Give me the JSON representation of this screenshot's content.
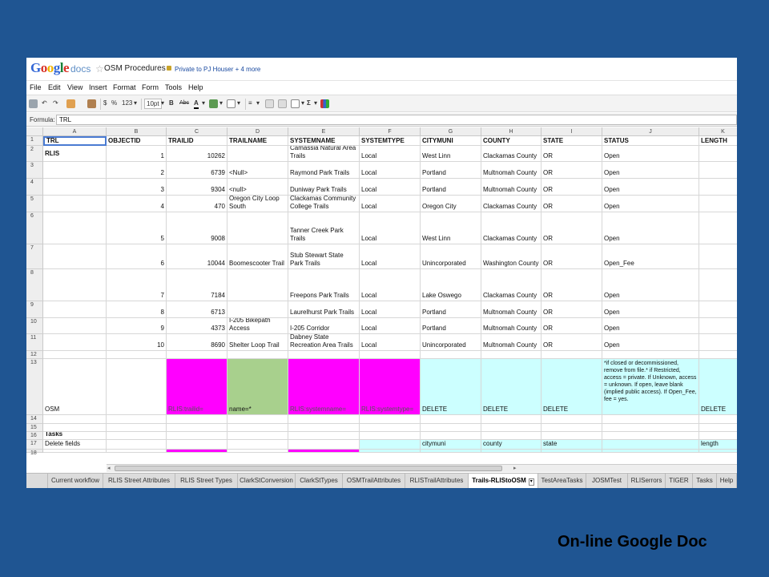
{
  "app": {
    "logo_google": "Google",
    "logo_docs": "docs",
    "doc_title": "OSM Procedures",
    "sharing": "Private to PJ Houser + 4 more"
  },
  "menu": [
    "File",
    "Edit",
    "View",
    "Insert",
    "Format",
    "Form",
    "Tools",
    "Help"
  ],
  "toolbar": {
    "currency": "$",
    "percent": "%",
    "number_format": "123",
    "font_size": "10pt",
    "bold": "B",
    "strike": "Abc",
    "text_color": "A",
    "sigma": "Σ"
  },
  "formula": {
    "label": "Formula:",
    "value": "TRL"
  },
  "columns": [
    "A",
    "B",
    "C",
    "D",
    "E",
    "F",
    "G",
    "H",
    "I",
    "J",
    "K"
  ],
  "row_numbers": [
    "1",
    "2",
    "3",
    "4",
    "5",
    "6",
    "7",
    "8",
    "9",
    "10",
    "11",
    "12",
    "13",
    "14",
    "15",
    "16",
    "17",
    "18"
  ],
  "header_row": [
    "TRL",
    "OBJECTID",
    "TRAILID",
    "TRAILNAME",
    "SYSTEMNAME",
    "SYSTEMTYPE",
    "CITYMUNI",
    "COUNTY",
    "STATE",
    "STATUS",
    "LENGTH"
  ],
  "rlis_label": "RLIS",
  "data_rows": [
    [
      "1",
      "10262",
      "",
      "Camassia Natural Area Trails",
      "Local",
      "West Linn",
      "Clackamas County",
      "OR",
      "Open"
    ],
    [
      "2",
      "6739",
      "<Null>",
      "Raymond Park Trails",
      "Local",
      "Portland",
      "Multnomah County",
      "OR",
      "Open"
    ],
    [
      "3",
      "9304",
      "<null>",
      "Duniway Park Trails",
      "Local",
      "Portland",
      "Multnomah County",
      "OR",
      "Open"
    ],
    [
      "4",
      "470",
      "Oregon City Loop South",
      "Clackamas Community College Trails",
      "Local",
      "Oregon City",
      "Clackamas County",
      "OR",
      "Open"
    ],
    [
      "5",
      "9008",
      "",
      "Tanner Creek Park Trails",
      "Local",
      "West Linn",
      "Clackamas County",
      "OR",
      "Open"
    ],
    [
      "6",
      "10044",
      "Boomescooter Trail",
      "Stub Stewart State Park Trails",
      "Local",
      "Unincorporated",
      "Washington County",
      "OR",
      "Open_Fee"
    ],
    [
      "7",
      "7184",
      "",
      "Freepons Park Trails",
      "Local",
      "Lake Oswego",
      "Clackamas County",
      "OR",
      "Open"
    ],
    [
      "8",
      "6713",
      "",
      "Laurelhurst Park Trails",
      "Local",
      "Portland",
      "Multnomah County",
      "OR",
      "Open"
    ],
    [
      "9",
      "4373",
      "I-205 Bikepath Access",
      "I-205 Corridor",
      "Local",
      "Portland",
      "Multnomah County",
      "OR",
      "Open"
    ],
    [
      "10",
      "8690",
      "Shelter Loop Trail",
      "Dabney State Recreation Area Trails",
      "Local",
      "Unincorporated",
      "Multnomah County",
      "OR",
      "Open"
    ]
  ],
  "osm_row": {
    "label": "OSM",
    "trailid": "RLIS:trailid=",
    "trailname": "name=*",
    "systemname": "RLIS:systemname=",
    "systemtype": "RLIS:systemtype=",
    "citymuni": "DELETE",
    "county": "DELETE",
    "state": "DELETE",
    "status": "*if closed or decommissioned, remove from file.* if Restricted, access = private. If Unknown, access = unknown. If open, leave blank (implied public access). If Open_Fee, fee = yes.",
    "length": "DELETE"
  },
  "tasks_label": "Tasks",
  "delete_row": {
    "label": "Delete fields",
    "citymuni": "citymuni",
    "county": "county",
    "state": "state",
    "length": "length"
  },
  "sheet_tabs": [
    "Current workflow",
    "RLIS Street Attributes",
    "RLIS Street Types",
    "ClarkStConversion",
    "ClarkStTypes",
    "OSMTrailAttributes",
    "RLISTrailAttributes",
    "Trails-RLIStoOSM",
    "TestAreaTasks",
    "JOSMTest",
    "RLISerrors",
    "TIGER",
    "Tasks",
    "Help"
  ],
  "active_tab": "Trails-RLIStoOSM",
  "caption": "On-line Google Doc",
  "colors": {
    "background": "#1f5592",
    "magenta": "#ff00ff",
    "green": "#a8d08d",
    "cyan": "#ccffff"
  }
}
